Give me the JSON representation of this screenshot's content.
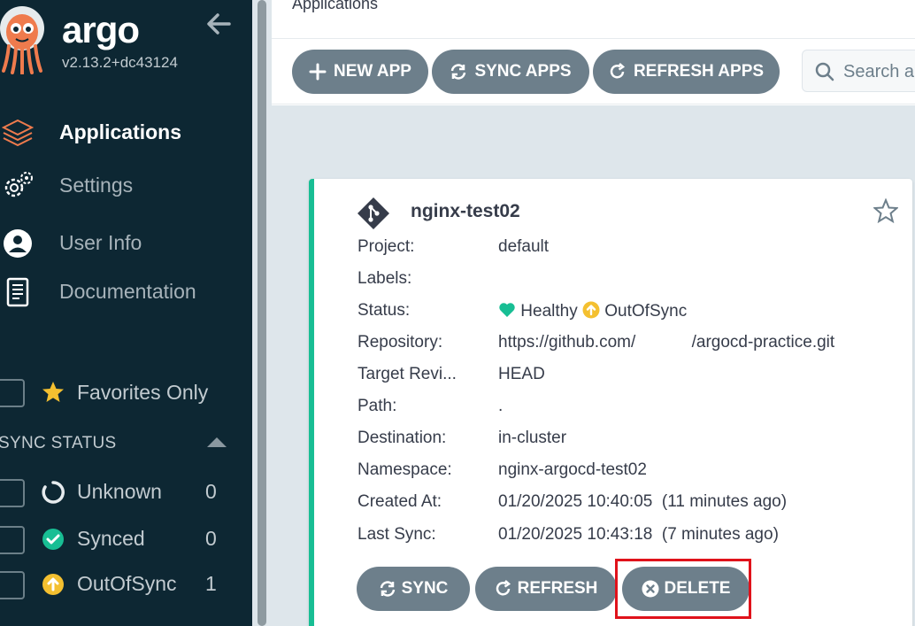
{
  "sidebar": {
    "brand": "argo",
    "version": "v2.13.2+dc43124",
    "nav": [
      {
        "label": "Applications",
        "icon": "layers-icon",
        "active": true
      },
      {
        "label": "Settings",
        "icon": "gear-icon"
      },
      {
        "label": "User Info",
        "icon": "user-icon"
      },
      {
        "label": "Documentation",
        "icon": "book-icon"
      }
    ],
    "favorites_label": "Favorites Only",
    "sync_status_title": "SYNC STATUS",
    "sync_filters": [
      {
        "label": "Unknown",
        "count": "0",
        "icon": "circle-notch-icon"
      },
      {
        "label": "Synced",
        "count": "0",
        "icon": "check-circle-icon"
      },
      {
        "label": "OutOfSync",
        "count": "1",
        "icon": "arrow-up-circle-icon"
      }
    ]
  },
  "header": {
    "title": "Applications"
  },
  "toolbar": {
    "new_app": "NEW APP",
    "sync_apps": "SYNC APPS",
    "refresh_apps": "REFRESH APPS",
    "search_placeholder": "Search a"
  },
  "app": {
    "name": "nginx-test02",
    "fields": [
      {
        "label": "Project:",
        "value": "default"
      },
      {
        "label": "Labels:",
        "value": ""
      },
      {
        "label": "Status:",
        "value": ""
      },
      {
        "label": "Repository:",
        "value": "https://github.com/            /argocd-practice.git"
      },
      {
        "label": "Target Revi...",
        "value": "HEAD"
      },
      {
        "label": "Path:",
        "value": "."
      },
      {
        "label": "Destination:",
        "value": "in-cluster"
      },
      {
        "label": "Namespace:",
        "value": "nginx-argocd-test02"
      },
      {
        "label": "Created At:",
        "value": "01/20/2025 10:40:05  (11 minutes ago)"
      },
      {
        "label": "Last Sync:",
        "value": "01/20/2025 10:43:18  (7 minutes ago)"
      }
    ],
    "health": "Healthy",
    "sync": "OutOfSync",
    "buttons": {
      "sync": "SYNC",
      "refresh": "REFRESH",
      "delete": "DELETE"
    }
  },
  "colors": {
    "sidebar_bg": "#0d2733",
    "button_bg": "#6d7f8b",
    "healthy": "#18be94",
    "out_of_sync": "#f4c030",
    "highlight": "#e0121b"
  }
}
